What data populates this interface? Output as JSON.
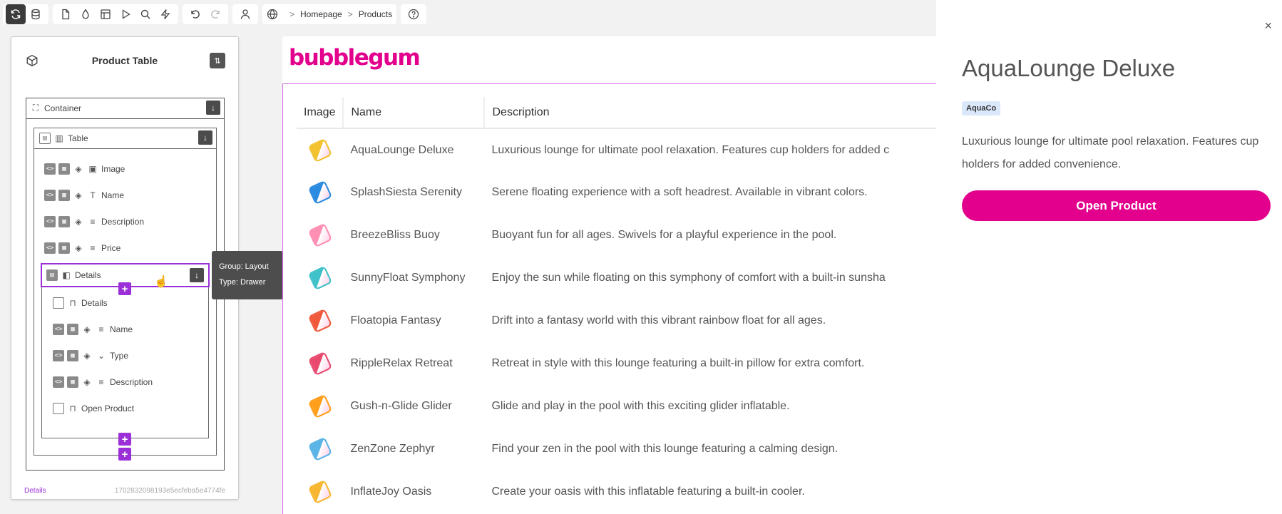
{
  "breadcrumbs": [
    "Homepage",
    "Products"
  ],
  "panel": {
    "title": "Product Table",
    "container": "Container",
    "table": "Table",
    "table_children": [
      {
        "label": "Image",
        "icon": "image-icon"
      },
      {
        "label": "Name",
        "icon": "text-type-icon"
      },
      {
        "label": "Description",
        "icon": "paragraph-icon"
      },
      {
        "label": "Price",
        "icon": "paragraph-icon"
      }
    ],
    "details": "Details",
    "details_children": [
      {
        "label": "Details",
        "icon": "bookmark-icon"
      },
      {
        "label": "Name",
        "icon": "paragraph-icon"
      },
      {
        "label": "Type",
        "icon": "chevron-down-icon"
      },
      {
        "label": "Description",
        "icon": "paragraph-icon"
      },
      {
        "label": "Open Product",
        "icon": "bookmark-icon"
      }
    ],
    "footer_left": "Details",
    "footer_right": "1702832098193e5ecfeba5e4774fe"
  },
  "tooltip": {
    "group": "Group: Layout",
    "type": "Type: Drawer"
  },
  "preview": {
    "logo": "bubblegum",
    "columns": [
      "Image",
      "Name",
      "Description"
    ],
    "rows": [
      {
        "name": "AquaLounge Deluxe",
        "description": "Luxurious lounge for ultimate pool relaxation. Features cup holders for added c",
        "color": "#f2c230"
      },
      {
        "name": "SplashSiesta Serenity",
        "description": "Serene floating experience with a soft headrest. Available in vibrant colors.",
        "color": "#2b8be0"
      },
      {
        "name": "BreezeBliss Buoy",
        "description": "Buoyant fun for all ages. Swivels for a playful experience in the pool.",
        "color": "#ff8fb3"
      },
      {
        "name": "SunnyFloat Symphony",
        "description": "Enjoy the sun while floating on this symphony of comfort with a built-in sunsha",
        "color": "#3ec1c9"
      },
      {
        "name": "Floatopia Fantasy",
        "description": "Drift into a fantasy world with this vibrant rainbow float for all ages.",
        "color": "#f05a3c"
      },
      {
        "name": "RippleRelax Retreat",
        "description": "Retreat in style with this lounge featuring a built-in pillow for extra comfort.",
        "color": "#e84a6f"
      },
      {
        "name": "Gush-n-Glide Glider",
        "description": "Glide and play in the pool with this exciting glider inflatable.",
        "color": "#ff9f1c"
      },
      {
        "name": "ZenZone Zephyr",
        "description": "Find your zen in the pool with this lounge featuring a calming design.",
        "color": "#5ab4e6"
      },
      {
        "name": "InflateJoy Oasis",
        "description": "Create your oasis with this inflatable featuring a built-in cooler.",
        "color": "#f7b733"
      }
    ]
  },
  "drawer": {
    "title": "AquaLounge Deluxe",
    "badge": "AquaCo",
    "description": "Luxurious lounge for ultimate pool relaxation. Features cup holders for added convenience.",
    "button": "Open Product",
    "close": "×"
  },
  "colors": {
    "brand": "#e3008c",
    "accent": "#9b30d9"
  }
}
